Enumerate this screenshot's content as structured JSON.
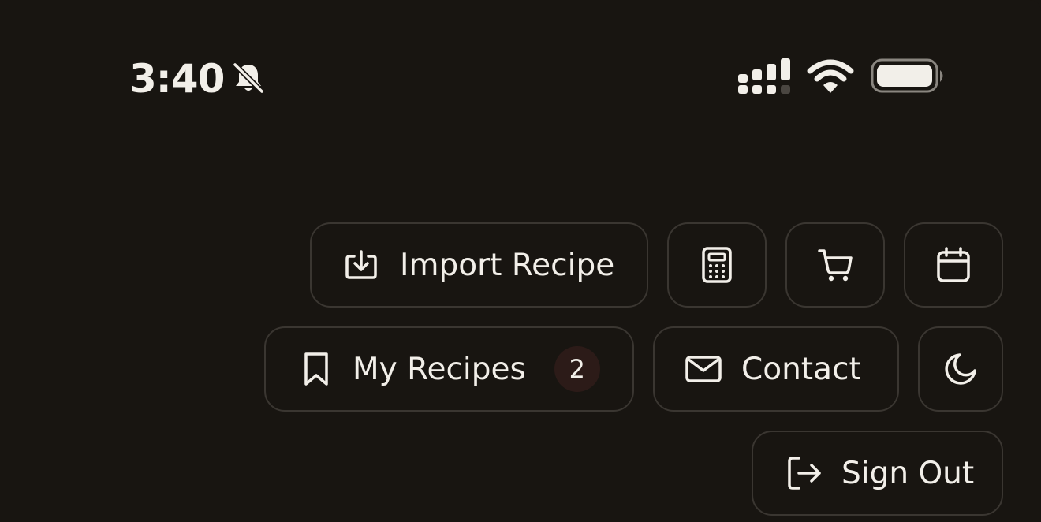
{
  "status_bar": {
    "time": "3:40",
    "icons": [
      "bell-slash-icon",
      "cellular-signal-icon",
      "wifi-icon",
      "battery-icon"
    ]
  },
  "actions": {
    "import_recipe": {
      "label": "Import Recipe",
      "icon": "import-icon"
    },
    "calculator": {
      "icon": "calculator-icon"
    },
    "cart": {
      "icon": "shopping-cart-icon"
    },
    "calendar": {
      "icon": "calendar-icon"
    },
    "my_recipes": {
      "label": "My Recipes",
      "icon": "bookmark-icon",
      "badge": "2"
    },
    "contact": {
      "label": "Contact",
      "icon": "mail-icon"
    },
    "theme": {
      "icon": "moon-icon"
    },
    "sign_out": {
      "label": "Sign Out",
      "icon": "sign-out-icon"
    }
  },
  "colors": {
    "background": "#181511",
    "border": "#3a3631",
    "text": "#f2efe9",
    "badge_bg": "#2c1b18"
  }
}
